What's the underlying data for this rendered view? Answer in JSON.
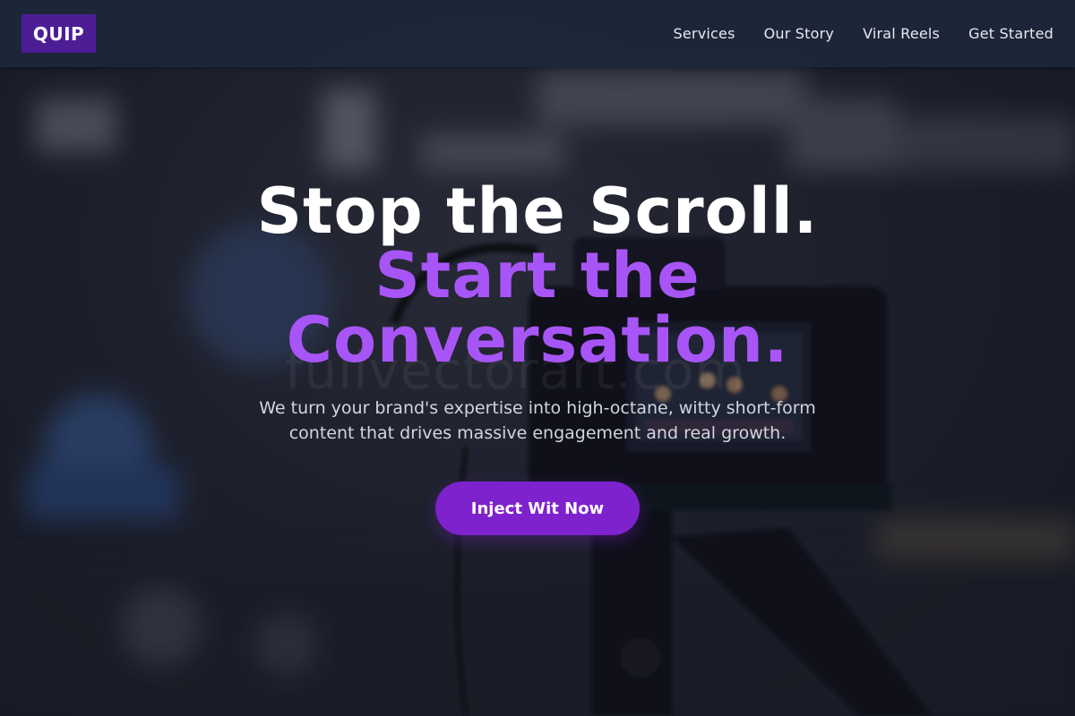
{
  "brand": {
    "logo_text": "QUIP",
    "logo_color": "#4c1d95",
    "accent_color": "#a855f7",
    "button_color": "#7e22ce"
  },
  "nav": {
    "items": [
      {
        "label": "Services"
      },
      {
        "label": "Our Story"
      },
      {
        "label": "Viral Reels"
      },
      {
        "label": "Get Started"
      }
    ]
  },
  "hero": {
    "headline_line1": "Stop the Scroll.",
    "headline_line2": "Start the Conversation.",
    "subtitle": "We turn your brand's expertise into high-octane, witty short-form content that drives massive engagement and real growth.",
    "cta_label": "Inject Wit Now",
    "background_image": "blurred video camera in studio",
    "background_watermark": "fullvectorart.com"
  }
}
